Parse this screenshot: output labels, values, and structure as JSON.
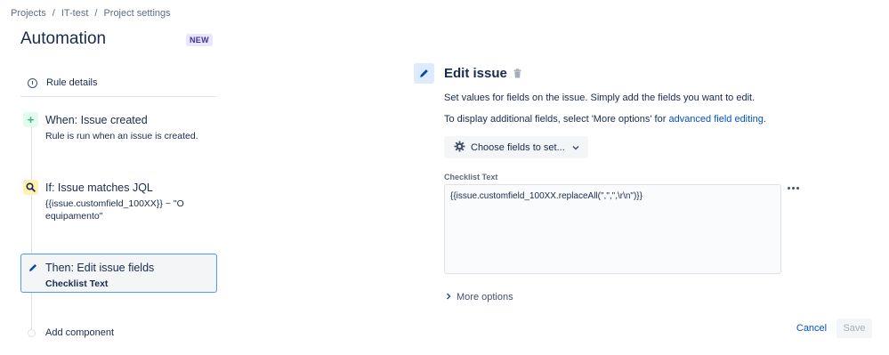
{
  "breadcrumb": {
    "items": [
      "Projects",
      "IT-test",
      "Project settings"
    ],
    "separator": "/"
  },
  "page": {
    "title": "Automation",
    "badge": "NEW"
  },
  "rule_details": {
    "label": "Rule details",
    "icon": "info-icon"
  },
  "steps": {
    "when": {
      "icon": "plus-icon",
      "icon_glyph": "+",
      "title": "When: Issue created",
      "subtitle": "Rule is run when an issue is created."
    },
    "if": {
      "icon": "search-icon",
      "title": "If: Issue matches JQL",
      "subtitle": "{{issue.customfield_100XX}} ~ \"O equipamento\""
    },
    "then": {
      "icon": "pencil-icon",
      "title": "Then: Edit issue fields",
      "subtitle": "Checklist Text"
    }
  },
  "add_component": {
    "label": "Add component"
  },
  "editor": {
    "title": "Edit issue",
    "description": "Set values for fields on the issue. Simply add the fields you want to edit.",
    "additional_prefix": "To display additional fields, select 'More options' for ",
    "additional_link": "advanced field editing",
    "additional_suffix": ".",
    "choose_fields_label": "Choose fields to set...",
    "field_label": "Checklist Text",
    "field_value": "{{issue.customfield_100XX.replaceAll(\",\",\",\\r\\n\")}}",
    "more_options_label": "More options",
    "cancel_label": "Cancel",
    "save_label": "Save"
  },
  "colors": {
    "link": "#0052cc",
    "selected_border": "#4c9aff",
    "when_icon_bg": "#e3fcef",
    "if_icon_bg": "#fff0b3",
    "edit_icon_bg": "#deebff",
    "badge_bg": "#eae6ff"
  }
}
